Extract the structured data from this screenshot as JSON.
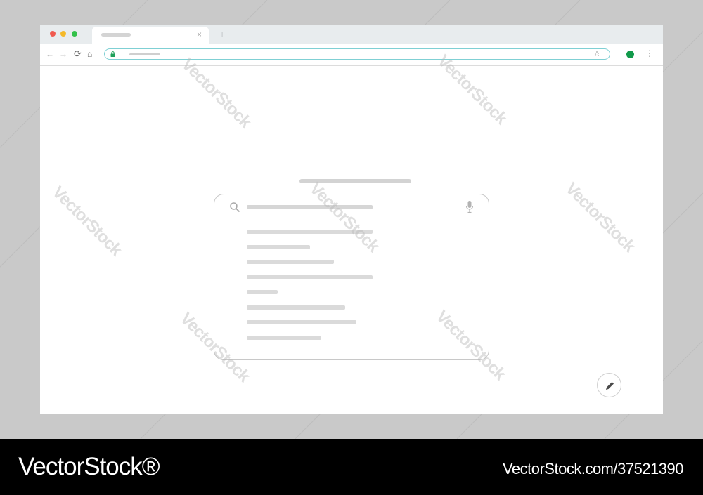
{
  "browser": {
    "tab": {
      "close_label": "×"
    },
    "new_tab_label": "+",
    "toolbar": {
      "back_label": "←",
      "forward_label": "→",
      "reload_label": "⟳",
      "home_label": "⌂",
      "star_label": "☆",
      "menu_label": "⋮"
    }
  },
  "icons": {
    "search": "search-icon",
    "mic": "mic-icon",
    "lock": "lock-icon",
    "edit": "pencil-icon"
  },
  "suggestions": [
    {
      "fill": 0.78
    },
    {
      "fill": 0.39
    },
    {
      "fill": 0.54
    },
    {
      "fill": 0.78
    },
    {
      "fill": 0.19
    },
    {
      "fill": 0.61
    },
    {
      "fill": 0.68
    },
    {
      "fill": 0.46
    }
  ],
  "watermark": {
    "text": "VectorStock"
  },
  "footer": {
    "brand": "VectorStock®",
    "id_text": "VectorStock.com/37521390"
  },
  "colors": {
    "omnibox_border": "#7fd0d4",
    "profile": "#119a4b",
    "lock": "#1fa05a"
  }
}
